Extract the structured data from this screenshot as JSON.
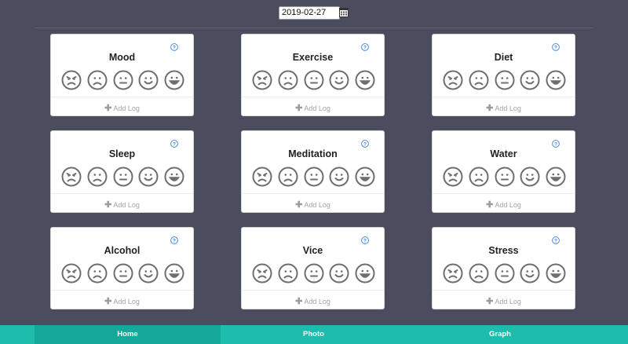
{
  "date_picker": {
    "value": "2019-02-27"
  },
  "cards": [
    {
      "title": "Mood",
      "add_log": "Add Log"
    },
    {
      "title": "Exercise",
      "add_log": "Add Log"
    },
    {
      "title": "Diet",
      "add_log": "Add Log"
    },
    {
      "title": "Sleep",
      "add_log": "Add Log"
    },
    {
      "title": "Meditation",
      "add_log": "Add Log"
    },
    {
      "title": "Water",
      "add_log": "Add Log"
    },
    {
      "title": "Alcohol",
      "add_log": "Add Log"
    },
    {
      "title": "Vice",
      "add_log": "Add Log"
    },
    {
      "title": "Stress",
      "add_log": "Add Log"
    }
  ],
  "rating_faces": [
    "angry-face-icon",
    "sad-face-icon",
    "neutral-face-icon",
    "smile-face-icon",
    "grin-face-icon"
  ],
  "tabs": [
    {
      "label": "Home",
      "active": true
    },
    {
      "label": "Photo",
      "active": false
    },
    {
      "label": "Graph",
      "active": false
    }
  ],
  "colors": {
    "background": "#4b4d5e",
    "accent": "#1ebcad",
    "tab_active": "#16a89b",
    "face_icon": "#6f6f6f",
    "help_icon": "#3b7dd8"
  }
}
